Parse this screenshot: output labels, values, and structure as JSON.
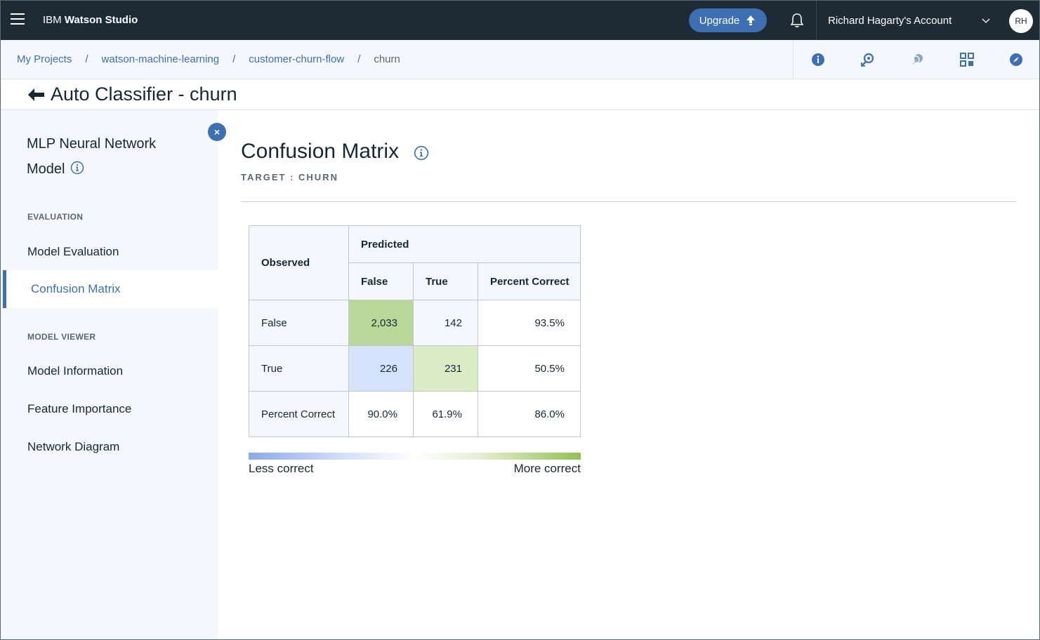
{
  "topbar": {
    "brand_prefix": "IBM",
    "brand_name": "Watson Studio",
    "upgrade_label": "Upgrade",
    "account_label": "Richard Hagarty's Account",
    "avatar_initials": "RH"
  },
  "breadcrumb": {
    "items": [
      "My Projects",
      "watson-machine-learning",
      "customer-churn-flow"
    ],
    "separator": "/",
    "current": "churn"
  },
  "page": {
    "title": "Auto Classifier - churn"
  },
  "sidebar": {
    "model_name": "MLP Neural Network Model",
    "sections": [
      {
        "heading": "EVALUATION",
        "items": [
          "Model Evaluation",
          "Confusion Matrix"
        ]
      },
      {
        "heading": "MODEL VIEWER",
        "items": [
          "Model Information",
          "Feature Importance",
          "Network Diagram"
        ]
      }
    ],
    "active_item": "Confusion Matrix"
  },
  "main": {
    "title": "Confusion Matrix",
    "target_label": "TARGET : CHURN"
  },
  "matrix": {
    "observed_header": "Observed",
    "predicted_header": "Predicted",
    "col_headers": [
      "False",
      "True",
      "Percent Correct"
    ],
    "rows": [
      {
        "label": "False",
        "cells": [
          "2,033",
          "142",
          "93.5%"
        ]
      },
      {
        "label": "True",
        "cells": [
          "226",
          "231",
          "50.5%"
        ]
      },
      {
        "label": "Percent Correct",
        "cells": [
          "90.0%",
          "61.9%",
          "86.0%"
        ]
      }
    ]
  },
  "legend": {
    "less": "Less correct",
    "more": "More correct"
  },
  "colors": {
    "topbar_bg": "#1f2b34",
    "accent": "#3d70b2",
    "cell_strong_green": "#b8d898",
    "cell_light_green": "#dbebc5",
    "cell_light_blue": "#d6e2fb",
    "cell_faint_blue": "#f4f7fe"
  }
}
